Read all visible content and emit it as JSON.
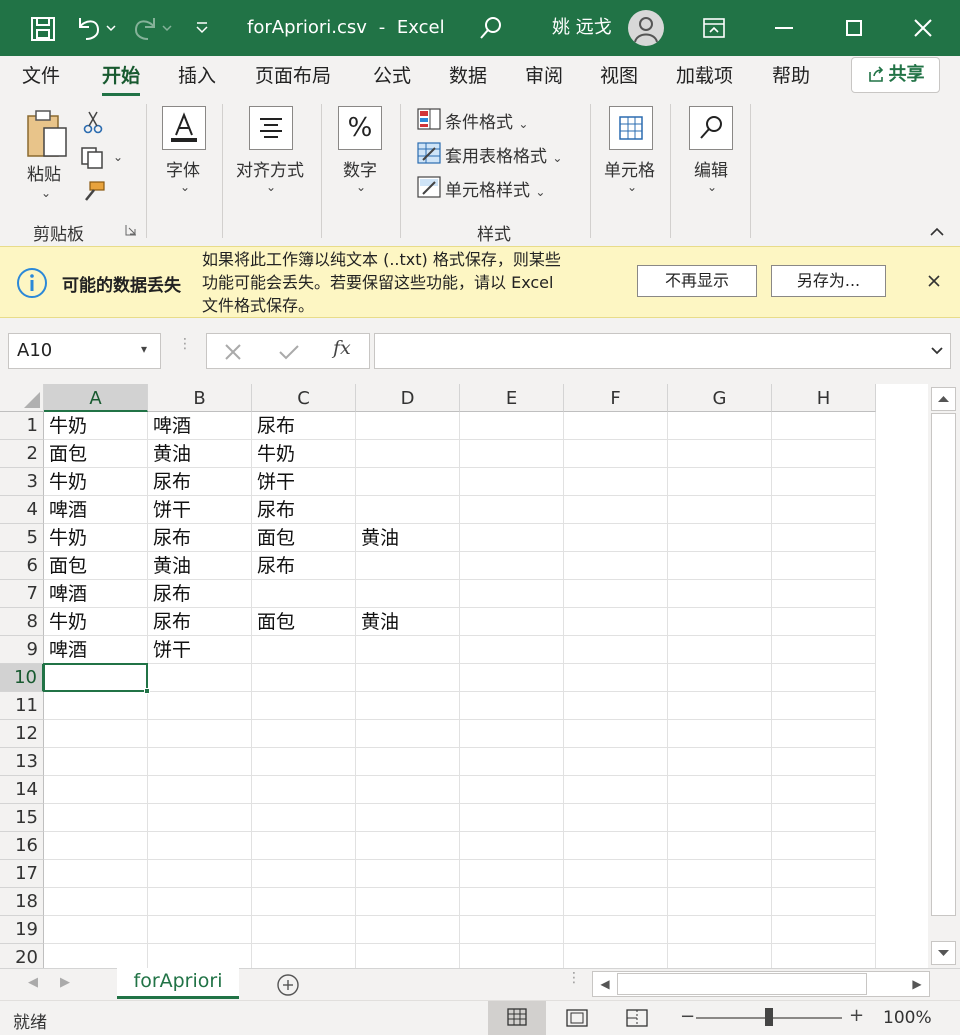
{
  "titlebar": {
    "file_name": "forApriori.csv",
    "separator": "-",
    "app": "Excel",
    "user": "姚 远戈"
  },
  "tabs": [
    "文件",
    "开始",
    "插入",
    "页面布局",
    "公式",
    "数据",
    "审阅",
    "视图",
    "加载项",
    "帮助"
  ],
  "active_tab": "开始",
  "share_label": "共享",
  "ribbon": {
    "paste": "粘贴",
    "clipboard": "剪贴板",
    "font": "字体",
    "align": "对齐方式",
    "number": "数字",
    "cond_format": "条件格式",
    "table_format": "套用表格格式",
    "cell_style": "单元格样式",
    "styles": "样式",
    "cells": "单元格",
    "edit": "编辑"
  },
  "message": {
    "title": "可能的数据丢失",
    "text_line1": "如果将此工作簿以纯文本 (..txt) 格式保存，则某些",
    "text_line2": "功能可能会丢失。若要保留这些功能，请以 Excel",
    "text_line3": "文件格式保存。",
    "btn_dismiss": "不再显示",
    "btn_saveas": "另存为..."
  },
  "formula_bar": {
    "name_box": "A10",
    "fx": "fx",
    "formula": ""
  },
  "columns": [
    "A",
    "B",
    "C",
    "D",
    "E",
    "F",
    "G",
    "H"
  ],
  "active_column": "A",
  "active_row": "10",
  "rows": [
    {
      "num": "1",
      "cells": [
        "牛奶",
        "啤酒",
        "尿布",
        ""
      ]
    },
    {
      "num": "2",
      "cells": [
        "面包",
        "黄油",
        "牛奶",
        ""
      ]
    },
    {
      "num": "3",
      "cells": [
        "牛奶",
        "尿布",
        "饼干",
        ""
      ]
    },
    {
      "num": "4",
      "cells": [
        "啤酒",
        "饼干",
        "尿布",
        ""
      ]
    },
    {
      "num": "5",
      "cells": [
        "牛奶",
        "尿布",
        "面包",
        "黄油"
      ]
    },
    {
      "num": "6",
      "cells": [
        "面包",
        "黄油",
        "尿布",
        ""
      ]
    },
    {
      "num": "7",
      "cells": [
        "啤酒",
        "尿布",
        "",
        ""
      ]
    },
    {
      "num": "8",
      "cells": [
        "牛奶",
        "尿布",
        "面包",
        "黄油"
      ]
    },
    {
      "num": "9",
      "cells": [
        "啤酒",
        "饼干",
        "",
        ""
      ]
    },
    {
      "num": "10",
      "cells": [
        "",
        "",
        "",
        ""
      ]
    },
    {
      "num": "11",
      "cells": [
        "",
        "",
        "",
        ""
      ]
    },
    {
      "num": "12",
      "cells": [
        "",
        "",
        "",
        ""
      ]
    },
    {
      "num": "13",
      "cells": [
        "",
        "",
        "",
        ""
      ]
    },
    {
      "num": "14",
      "cells": [
        "",
        "",
        "",
        ""
      ]
    },
    {
      "num": "15",
      "cells": [
        "",
        "",
        "",
        ""
      ]
    },
    {
      "num": "16",
      "cells": [
        "",
        "",
        "",
        ""
      ]
    },
    {
      "num": "17",
      "cells": [
        "",
        "",
        "",
        ""
      ]
    },
    {
      "num": "18",
      "cells": [
        "",
        "",
        "",
        ""
      ]
    },
    {
      "num": "19",
      "cells": [
        "",
        "",
        "",
        ""
      ]
    },
    {
      "num": "20",
      "cells": [
        "",
        "",
        "",
        ""
      ]
    }
  ],
  "sheet_tab": "forApriori",
  "status": {
    "ready": "就绪",
    "zoom": "100%",
    "zoom_minus": "−",
    "zoom_plus": "+"
  },
  "colors": {
    "accent": "#217346",
    "message_bg": "#fdf6c3",
    "info": "#2b88d8"
  },
  "icons": [
    "save-icon",
    "undo-icon",
    "redo-icon",
    "customize-icon",
    "search-icon",
    "user-avatar-icon",
    "ribbon-display-icon",
    "minimize-icon",
    "maximize-icon",
    "close-icon",
    "share-icon",
    "paste-icon",
    "cut-icon",
    "copy-icon",
    "format-painter-icon",
    "font-icon",
    "align-icon",
    "percent-icon",
    "conditional-format-icon",
    "table-format-icon",
    "cell-style-icon",
    "cells-icon",
    "find-icon",
    "info-icon",
    "cancel-icon",
    "enter-icon",
    "fx-icon"
  ]
}
